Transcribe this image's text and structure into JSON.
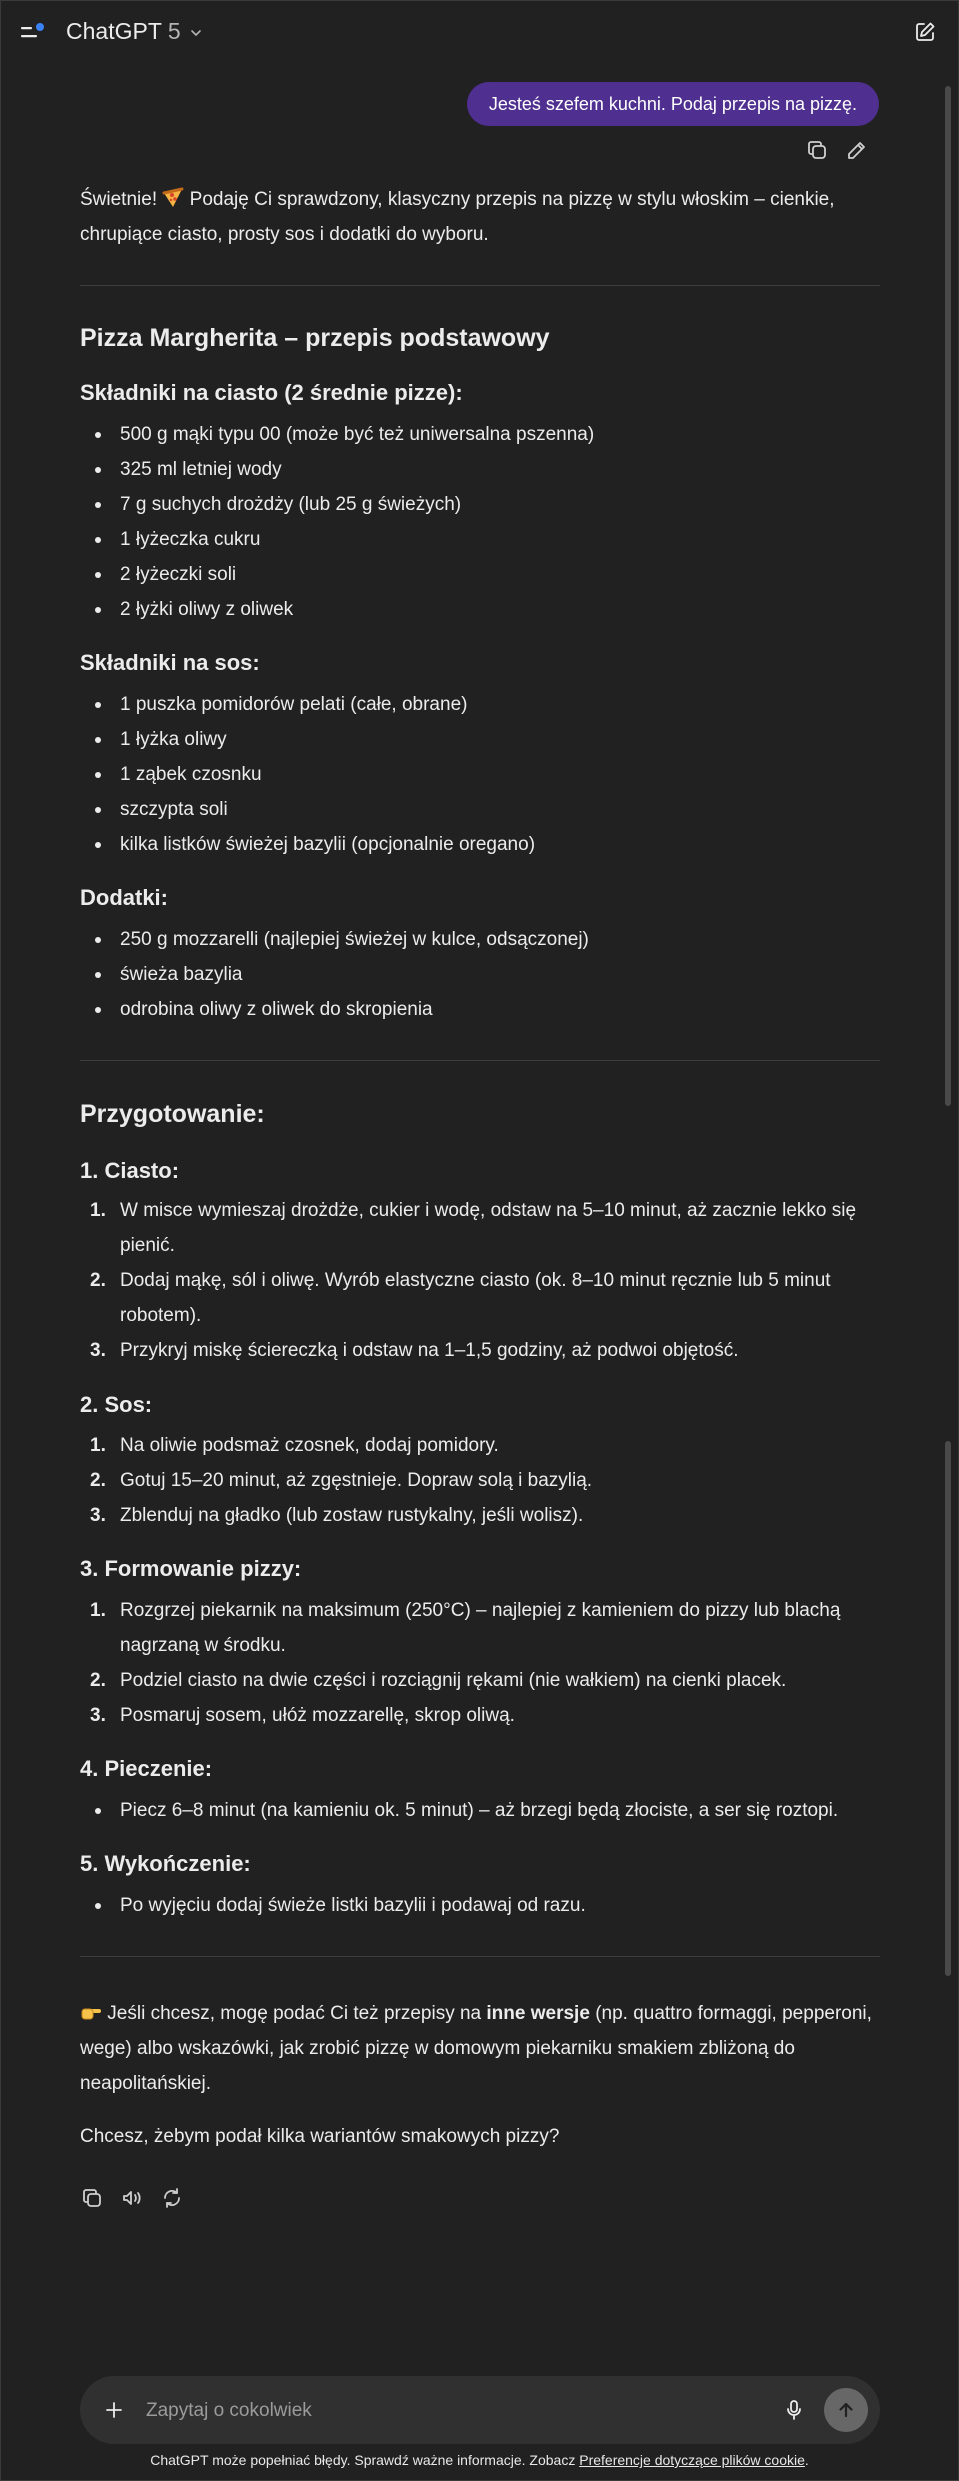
{
  "header": {
    "brand": "ChatGPT",
    "version": "5"
  },
  "user_message": "Jesteś szefem kuchni. Podaj przepis na pizzę.",
  "answer": {
    "intro": "Świetnie! 🍕 Podaję Ci sprawdzony, klasyczny przepis na pizzę w stylu włoskim – cienkie, chrupiące ciasto, prosty sos i dodatki do wyboru.",
    "intro_before_emoji": "Świetnie!",
    "intro_after_emoji": "Podaję Ci sprawdzony, klasyczny przepis na pizzę w stylu włoskim – cienkie, chrupiące ciasto, prosty sos i dodatki do wyboru.",
    "title": "Pizza Margherita – przepis podstawowy",
    "dough_heading": "Składniki na ciasto (2 średnie pizze):",
    "dough_items": [
      "500 g mąki typu 00 (może być też uniwersalna pszenna)",
      "325 ml letniej wody",
      "7 g suchych drożdży (lub 25 g świeżych)",
      "1 łyżeczka cukru",
      "2 łyżeczki soli",
      "2 łyżki oliwy z oliwek"
    ],
    "sauce_heading": "Składniki na sos:",
    "sauce_items": [
      "1 puszka pomidorów pelati (całe, obrane)",
      "1 łyżka oliwy",
      "1 ząbek czosnku",
      "szczypta soli",
      "kilka listków świeżej bazylii (opcjonalnie oregano)"
    ],
    "toppings_heading": "Dodatki:",
    "toppings_items": [
      "250 g mozzarelli (najlepiej świeżej w kulce, odsączonej)",
      "świeża bazylia",
      "odrobina oliwy z oliwek do skropienia"
    ],
    "prep_heading": "Przygotowanie:",
    "step1_heading": "1. Ciasto:",
    "step1_items": [
      "W misce wymieszaj drożdże, cukier i wodę, odstaw na 5–10 minut, aż zacznie lekko się pienić.",
      "Dodaj mąkę, sól i oliwę. Wyrób elastyczne ciasto (ok. 8–10 minut ręcznie lub 5 minut robotem).",
      "Przykryj miskę ściereczką i odstaw na 1–1,5 godziny, aż podwoi objętość."
    ],
    "step2_heading": "2. Sos:",
    "step2_items": [
      "Na oliwie podsmaż czosnek, dodaj pomidory.",
      "Gotuj 15–20 minut, aż zgęstnieje. Dopraw solą i bazylią.",
      "Zblenduj na gładko (lub zostaw rustykalny, jeśli wolisz)."
    ],
    "step3_heading": "3. Formowanie pizzy:",
    "step3_items": [
      "Rozgrzej piekarnik na maksimum (250°C) – najlepiej z kamieniem do pizzy lub blachą nagrzaną w środku.",
      "Podziel ciasto na dwie części i rozciągnij rękami (nie wałkiem) na cienki placek.",
      "Posmaruj sosem, ułóż mozzarellę, skrop oliwą."
    ],
    "step4_heading": "4. Pieczenie:",
    "step4_items": [
      "Piecz 6–8 minut (na kamieniu ok. 5 minut) – aż brzegi będą złociste, a ser się roztopi."
    ],
    "step5_heading": "5. Wykończenie:",
    "step5_items": [
      "Po wyjęciu dodaj świeże listki bazylii i podawaj od razu."
    ],
    "offer_pre": "Jeśli chcesz, mogę podać Ci też przepisy na",
    "offer_bold": "inne wersje",
    "offer_post": "(np. quattro formaggi, pepperoni, wege) albo wskazówki, jak zrobić pizzę w domowym piekarniku smakiem zbliżoną do neapolitańskiej.",
    "question": "Chcesz, żebym podał kilka wariantów smakowych pizzy?"
  },
  "composer": {
    "placeholder": "Zapytaj o cokolwiek"
  },
  "footer": {
    "text": "ChatGPT może popełniać błędy. Sprawdź ważne informacje. Zobacz",
    "link": "Preferencje dotyczące plików cookie",
    "end": "."
  },
  "icons": {
    "menu": "sidebar-menu-icon",
    "new_chat": "edit-square-icon",
    "copy": "copy-icon",
    "edit": "pencil-icon",
    "read_aloud": "speaker-icon",
    "regenerate": "refresh-icon",
    "plus": "plus-icon",
    "mic": "microphone-icon",
    "send": "arrow-up-icon"
  },
  "colors": {
    "background": "#212121",
    "user_bubble": "#4f2f8f",
    "composer": "#303030",
    "accent_dot": "#3b82f6"
  }
}
